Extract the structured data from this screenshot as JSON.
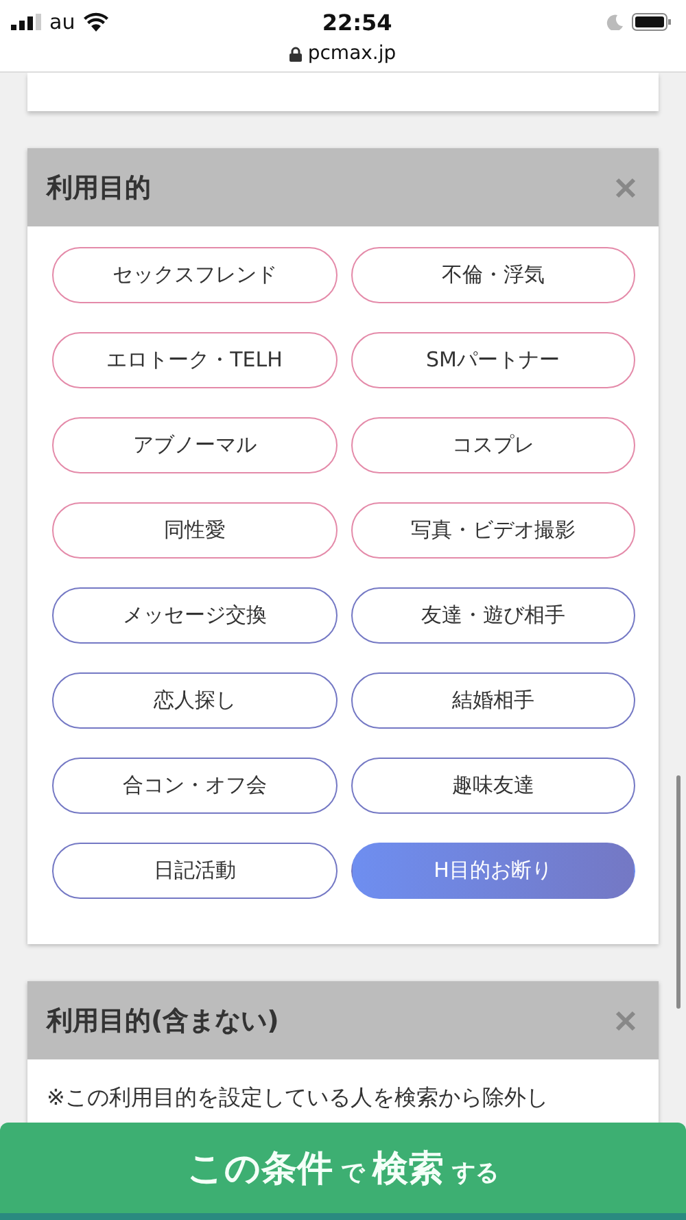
{
  "status_bar": {
    "carrier": "au",
    "time": "22:54",
    "url": "pcmax.jp"
  },
  "sections": [
    {
      "title": "利用目的",
      "chips": [
        {
          "label": "セックスフレンド",
          "color": "#e48aa9",
          "selected": false
        },
        {
          "label": "不倫・浮気",
          "color": "#e48aa9",
          "selected": false
        },
        {
          "label": "エロトーク・TELH",
          "color": "#e48aa9",
          "selected": false
        },
        {
          "label": "SMパートナー",
          "color": "#e48aa9",
          "selected": false
        },
        {
          "label": "アブノーマル",
          "color": "#e48aa9",
          "selected": false
        },
        {
          "label": "コスプレ",
          "color": "#e48aa9",
          "selected": false
        },
        {
          "label": "同性愛",
          "color": "#e48aa9",
          "selected": false
        },
        {
          "label": "写真・ビデオ撮影",
          "color": "#e48aa9",
          "selected": false
        },
        {
          "label": "メッセージ交換",
          "color": "#7478c4",
          "selected": false
        },
        {
          "label": "友達・遊び相手",
          "color": "#7478c4",
          "selected": false
        },
        {
          "label": "恋人探し",
          "color": "#7478c4",
          "selected": false
        },
        {
          "label": "結婚相手",
          "color": "#7478c4",
          "selected": false
        },
        {
          "label": "合コン・オフ会",
          "color": "#7478c4",
          "selected": false
        },
        {
          "label": "趣味友達",
          "color": "#7478c4",
          "selected": false
        },
        {
          "label": "日記活動",
          "color": "#7478c4",
          "selected": false
        },
        {
          "label": "H目的お断り",
          "color": "#7478c4",
          "selected": true
        }
      ]
    },
    {
      "title": "利用目的(含まない)",
      "note": "※この利用目的を設定している人を検索から除外し"
    }
  ],
  "search_button": "**この条件** で **検索** する"
}
